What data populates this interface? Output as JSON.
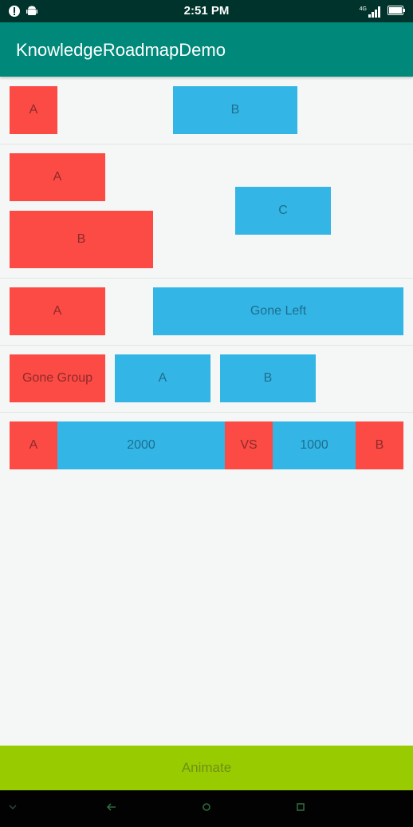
{
  "status_bar": {
    "time": "2:51 PM",
    "network": "4G",
    "icons": [
      "notification-icon",
      "android-icon",
      "signal-icon",
      "battery-icon"
    ]
  },
  "app_bar": {
    "title": "KnowledgeRoadmapDemo"
  },
  "rows": {
    "row1": {
      "a": "A",
      "b": "B"
    },
    "row2": {
      "a": "A",
      "b": "B",
      "c": "C"
    },
    "row3": {
      "a": "A",
      "gone_left": "Gone Left"
    },
    "row4": {
      "gone_group": "Gone Group",
      "a": "A",
      "b": "B"
    },
    "row5": {
      "a": "A",
      "value_2000": "2000",
      "vs": "VS",
      "value_1000": "1000",
      "b": "B"
    }
  },
  "animate_button": {
    "label": "Animate"
  },
  "nav_bar": {
    "icons": [
      "down-icon",
      "back-icon",
      "home-icon",
      "recents-icon"
    ]
  },
  "colors": {
    "red": "#fc4a44",
    "blue": "#33b5e5",
    "appbar": "#00897b",
    "statusbar": "#00332b",
    "animate": "#99cc00"
  }
}
